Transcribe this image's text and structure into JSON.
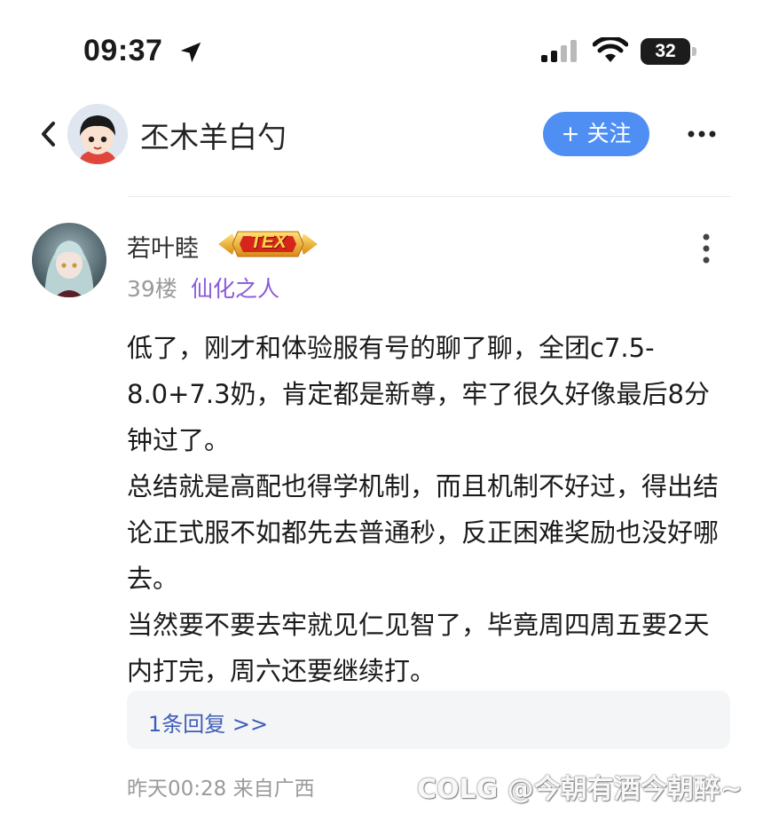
{
  "status_bar": {
    "time": "09:37",
    "battery": "32"
  },
  "header": {
    "username": "丕木羊白勺",
    "follow_label": "+ 关注"
  },
  "comment": {
    "username": "若叶睦",
    "badge_text": "TEX",
    "floor": "39楼",
    "title": "仙化之人",
    "paragraphs": [
      "低了，刚才和体验服有号的聊了聊，全团c7.5-8.0+7.3奶，肯定都是新尊，牢了很久好像最后8分钟过了。",
      "总结就是高配也得学机制，而且机制不好过，得出结论正式服不如都先去普通秒，反正困难奖励也没好哪去。",
      "当然要不要去牢就见仁见智了，毕竟周四周五要2天内打完，周六还要继续打。"
    ],
    "reply_link": "1条回复 >>",
    "meta": "昨天00:28 来自广西"
  },
  "watermark": "COLG @今朝有酒今朝醉~",
  "colors": {
    "accent": "#4f8ff4",
    "title_purple": "#8a5ad8",
    "link_blue": "#3f5db8"
  }
}
